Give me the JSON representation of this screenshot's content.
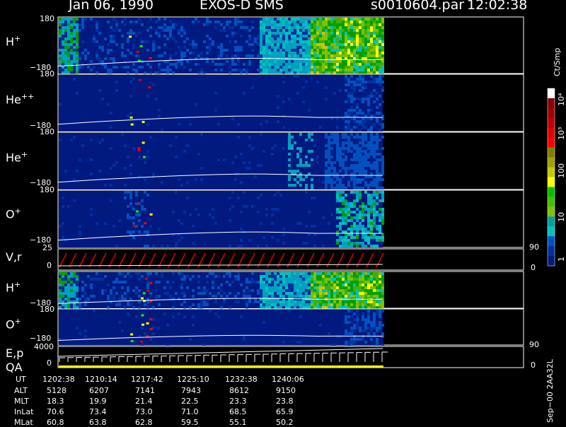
{
  "header": {
    "date": "Jan 06, 1990",
    "instrument": "EXOS-D SMS",
    "file": "s0010604.par",
    "time": "12:02:38"
  },
  "panels": {
    "hplus_top": {
      "label": "H",
      "sup": "+",
      "ymax": "180",
      "ymin": "−180"
    },
    "heplusplus": {
      "label": "He",
      "sup": "++",
      "ymax": "180",
      "ymin": "−180"
    },
    "heplus": {
      "label": "He",
      "sup": "+",
      "ymax": "180",
      "ymin": "−180"
    },
    "oplus_top": {
      "label": "O",
      "sup": "+",
      "ymax": "180",
      "ymin": "−180"
    },
    "vr": {
      "label": "V,r",
      "ymax": "25",
      "ymin": "0",
      "right_top": "90",
      "right_bottom": "0"
    },
    "hplus_bottom": {
      "label": "H",
      "sup": "+",
      "ymin": "−180"
    },
    "oplus_bottom": {
      "label": "O",
      "sup": "+",
      "ymax": "180",
      "ymin": "−180"
    },
    "ep_qa": {
      "label1": "E,p",
      "label2": "QA",
      "ymax": "4000",
      "ymin": "0",
      "right_top": "90",
      "right_bottom": "0"
    }
  },
  "colorbar": {
    "unit": "Ct/Smp",
    "ticks": [
      "10⁴",
      "10³",
      "100",
      "10",
      "1"
    ],
    "colors": [
      "#ffffff",
      "#8b0000",
      "#a00000",
      "#c00000",
      "#e00000",
      "#ff0000",
      "#808000",
      "#a0a000",
      "#c8c800",
      "#ffff00",
      "#00c000",
      "#40c000",
      "#80c000",
      "#00a0a0",
      "#00c0c0",
      "#0050c0",
      "#0030a0",
      "#001a80"
    ]
  },
  "footer_code": "Sep−00  2AA32L",
  "ephemeris": {
    "rows": [
      {
        "name": "UT",
        "values": [
          "1202:38",
          "1210:14",
          "1217:42",
          "1225:10",
          "1232:38",
          "1240:06"
        ]
      },
      {
        "name": "ALT",
        "values": [
          "5128",
          "6207",
          "7141",
          "7943",
          "8612",
          "9150"
        ]
      },
      {
        "name": "MLT",
        "values": [
          "18.3",
          "19.9",
          "21.4",
          "22.5",
          "23.3",
          "23.8"
        ]
      },
      {
        "name": "InLat",
        "values": [
          "70.6",
          "73.4",
          "73.0",
          "71.0",
          "68.5",
          "65.9"
        ]
      },
      {
        "name": "MLat",
        "values": [
          "60.8",
          "63.8",
          "62.8",
          "59.5",
          "55.1",
          "50.2"
        ]
      }
    ]
  },
  "chart_data": {
    "type": "heatmap",
    "title": "Jan 06, 1990   EXOS-D SMS",
    "x": [
      "1202:38",
      "1210:14",
      "1217:42",
      "1225:10",
      "1232:38",
      "1240:06"
    ],
    "series": [
      {
        "name": "H+",
        "ylim": [
          -180,
          180
        ]
      },
      {
        "name": "He++",
        "ylim": [
          -180,
          180
        ]
      },
      {
        "name": "He+",
        "ylim": [
          -180,
          180
        ]
      },
      {
        "name": "O+",
        "ylim": [
          -180,
          180
        ]
      },
      {
        "name": "V,r",
        "ylim": [
          0,
          25
        ]
      },
      {
        "name": "H+",
        "ylim": [
          -180,
          180
        ]
      },
      {
        "name": "O+",
        "ylim": [
          -180,
          180
        ]
      },
      {
        "name": "E,p",
        "ylim": [
          0,
          4000
        ]
      }
    ],
    "colorscale_unit": "Ct/Smp",
    "colorscale_ticks": [
      1,
      10,
      100,
      1000,
      10000
    ],
    "grid": false
  }
}
